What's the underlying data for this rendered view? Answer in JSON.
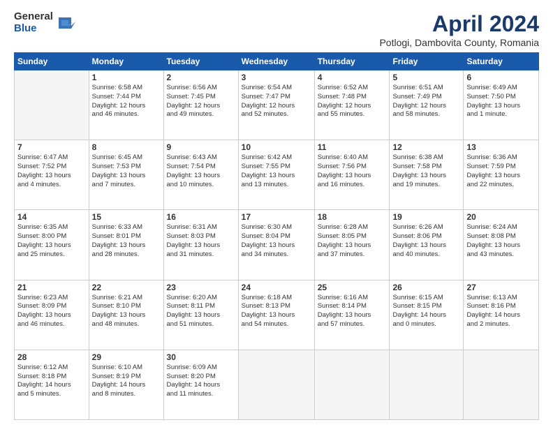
{
  "logo": {
    "general": "General",
    "blue": "Blue"
  },
  "title": "April 2024",
  "location": "Potlogi, Dambovita County, Romania",
  "weekdays": [
    "Sunday",
    "Monday",
    "Tuesday",
    "Wednesday",
    "Thursday",
    "Friday",
    "Saturday"
  ],
  "weeks": [
    [
      {
        "day": "",
        "info": ""
      },
      {
        "day": "1",
        "info": "Sunrise: 6:58 AM\nSunset: 7:44 PM\nDaylight: 12 hours\nand 46 minutes."
      },
      {
        "day": "2",
        "info": "Sunrise: 6:56 AM\nSunset: 7:45 PM\nDaylight: 12 hours\nand 49 minutes."
      },
      {
        "day": "3",
        "info": "Sunrise: 6:54 AM\nSunset: 7:47 PM\nDaylight: 12 hours\nand 52 minutes."
      },
      {
        "day": "4",
        "info": "Sunrise: 6:52 AM\nSunset: 7:48 PM\nDaylight: 12 hours\nand 55 minutes."
      },
      {
        "day": "5",
        "info": "Sunrise: 6:51 AM\nSunset: 7:49 PM\nDaylight: 12 hours\nand 58 minutes."
      },
      {
        "day": "6",
        "info": "Sunrise: 6:49 AM\nSunset: 7:50 PM\nDaylight: 13 hours\nand 1 minute."
      }
    ],
    [
      {
        "day": "7",
        "info": "Sunrise: 6:47 AM\nSunset: 7:52 PM\nDaylight: 13 hours\nand 4 minutes."
      },
      {
        "day": "8",
        "info": "Sunrise: 6:45 AM\nSunset: 7:53 PM\nDaylight: 13 hours\nand 7 minutes."
      },
      {
        "day": "9",
        "info": "Sunrise: 6:43 AM\nSunset: 7:54 PM\nDaylight: 13 hours\nand 10 minutes."
      },
      {
        "day": "10",
        "info": "Sunrise: 6:42 AM\nSunset: 7:55 PM\nDaylight: 13 hours\nand 13 minutes."
      },
      {
        "day": "11",
        "info": "Sunrise: 6:40 AM\nSunset: 7:56 PM\nDaylight: 13 hours\nand 16 minutes."
      },
      {
        "day": "12",
        "info": "Sunrise: 6:38 AM\nSunset: 7:58 PM\nDaylight: 13 hours\nand 19 minutes."
      },
      {
        "day": "13",
        "info": "Sunrise: 6:36 AM\nSunset: 7:59 PM\nDaylight: 13 hours\nand 22 minutes."
      }
    ],
    [
      {
        "day": "14",
        "info": "Sunrise: 6:35 AM\nSunset: 8:00 PM\nDaylight: 13 hours\nand 25 minutes."
      },
      {
        "day": "15",
        "info": "Sunrise: 6:33 AM\nSunset: 8:01 PM\nDaylight: 13 hours\nand 28 minutes."
      },
      {
        "day": "16",
        "info": "Sunrise: 6:31 AM\nSunset: 8:03 PM\nDaylight: 13 hours\nand 31 minutes."
      },
      {
        "day": "17",
        "info": "Sunrise: 6:30 AM\nSunset: 8:04 PM\nDaylight: 13 hours\nand 34 minutes."
      },
      {
        "day": "18",
        "info": "Sunrise: 6:28 AM\nSunset: 8:05 PM\nDaylight: 13 hours\nand 37 minutes."
      },
      {
        "day": "19",
        "info": "Sunrise: 6:26 AM\nSunset: 8:06 PM\nDaylight: 13 hours\nand 40 minutes."
      },
      {
        "day": "20",
        "info": "Sunrise: 6:24 AM\nSunset: 8:08 PM\nDaylight: 13 hours\nand 43 minutes."
      }
    ],
    [
      {
        "day": "21",
        "info": "Sunrise: 6:23 AM\nSunset: 8:09 PM\nDaylight: 13 hours\nand 46 minutes."
      },
      {
        "day": "22",
        "info": "Sunrise: 6:21 AM\nSunset: 8:10 PM\nDaylight: 13 hours\nand 48 minutes."
      },
      {
        "day": "23",
        "info": "Sunrise: 6:20 AM\nSunset: 8:11 PM\nDaylight: 13 hours\nand 51 minutes."
      },
      {
        "day": "24",
        "info": "Sunrise: 6:18 AM\nSunset: 8:13 PM\nDaylight: 13 hours\nand 54 minutes."
      },
      {
        "day": "25",
        "info": "Sunrise: 6:16 AM\nSunset: 8:14 PM\nDaylight: 13 hours\nand 57 minutes."
      },
      {
        "day": "26",
        "info": "Sunrise: 6:15 AM\nSunset: 8:15 PM\nDaylight: 14 hours\nand 0 minutes."
      },
      {
        "day": "27",
        "info": "Sunrise: 6:13 AM\nSunset: 8:16 PM\nDaylight: 14 hours\nand 2 minutes."
      }
    ],
    [
      {
        "day": "28",
        "info": "Sunrise: 6:12 AM\nSunset: 8:18 PM\nDaylight: 14 hours\nand 5 minutes."
      },
      {
        "day": "29",
        "info": "Sunrise: 6:10 AM\nSunset: 8:19 PM\nDaylight: 14 hours\nand 8 minutes."
      },
      {
        "day": "30",
        "info": "Sunrise: 6:09 AM\nSunset: 8:20 PM\nDaylight: 14 hours\nand 11 minutes."
      },
      {
        "day": "",
        "info": ""
      },
      {
        "day": "",
        "info": ""
      },
      {
        "day": "",
        "info": ""
      },
      {
        "day": "",
        "info": ""
      }
    ]
  ]
}
